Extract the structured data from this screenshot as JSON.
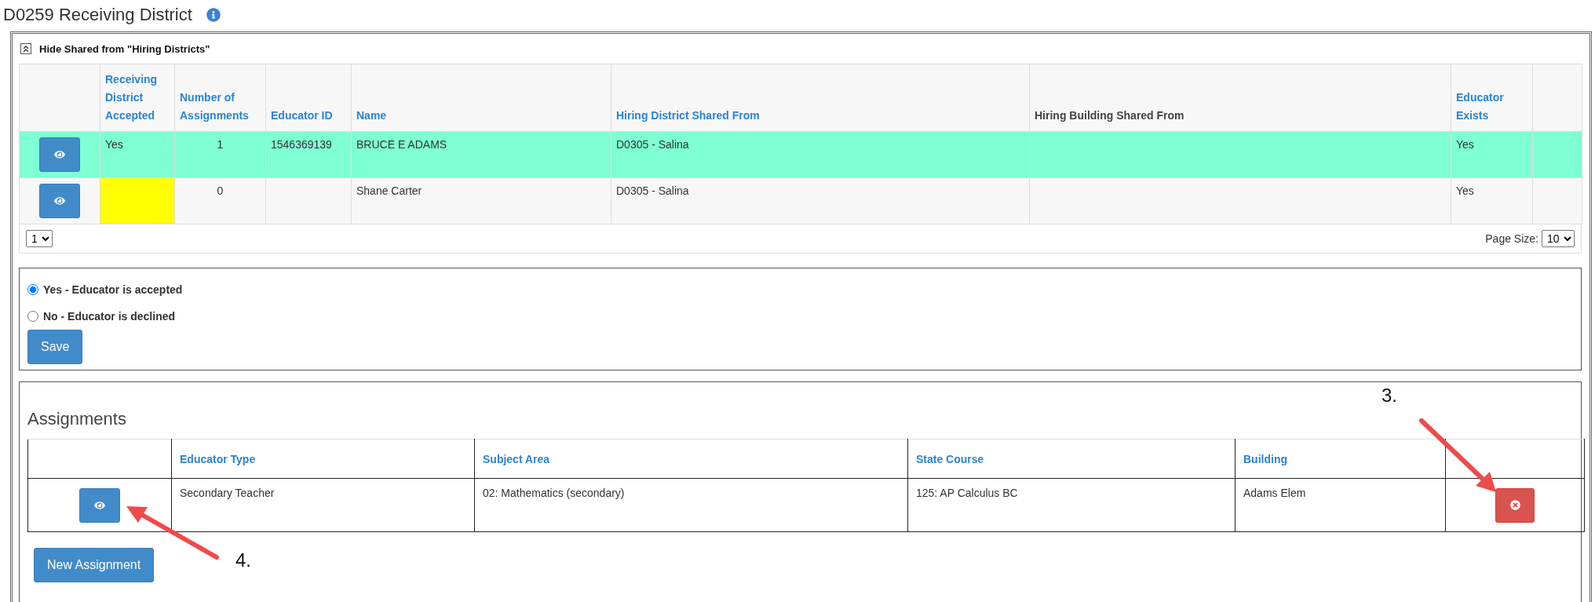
{
  "title": "D0259 Receiving District",
  "shared": {
    "toggle_label": "Hide Shared from \"Hiring Districts\"",
    "columns": [
      {
        "label": "Receiving District Accepted",
        "sortable": true
      },
      {
        "label": "Number of Assignments",
        "sortable": true
      },
      {
        "label": "Educator ID",
        "sortable": true
      },
      {
        "label": "Name",
        "sortable": true
      },
      {
        "label": "Hiring District Shared From",
        "sortable": true
      },
      {
        "label": "Hiring Building Shared From",
        "sortable": false
      },
      {
        "label": "Educator Exists",
        "sortable": true
      }
    ],
    "rows": [
      {
        "selected": true,
        "flagged": false,
        "accepted": "Yes",
        "assignments": "1",
        "educator_id": "1546369139",
        "name": "BRUCE E ADAMS",
        "district": "D0305 - Salina",
        "exists": "Yes"
      },
      {
        "selected": false,
        "flagged": true,
        "assignments": "0",
        "name": "Shane Carter",
        "district": "D0305 - Salina",
        "exists": "Yes"
      }
    ],
    "page": "1",
    "page_size_label": "Page Size:",
    "page_size": "10"
  },
  "decision": {
    "options": [
      {
        "label": "Yes - Educator is accepted",
        "selected": true
      },
      {
        "label": "No - Educator is declined",
        "selected": false
      }
    ],
    "save": "Save"
  },
  "assignments": {
    "heading": "Assignments",
    "columns": [
      "Educator Type",
      "Subject Area",
      "State Course",
      "Building"
    ],
    "rows": [
      {
        "educator_type": "Secondary Teacher",
        "subject_area": "02: Mathematics (secondary)",
        "state_course": "125: AP Calculus BC",
        "building": "Adams Elem"
      }
    ],
    "new_button": "New Assignment"
  },
  "annotations": [
    {
      "label": "3."
    },
    {
      "label": "4."
    }
  ]
}
